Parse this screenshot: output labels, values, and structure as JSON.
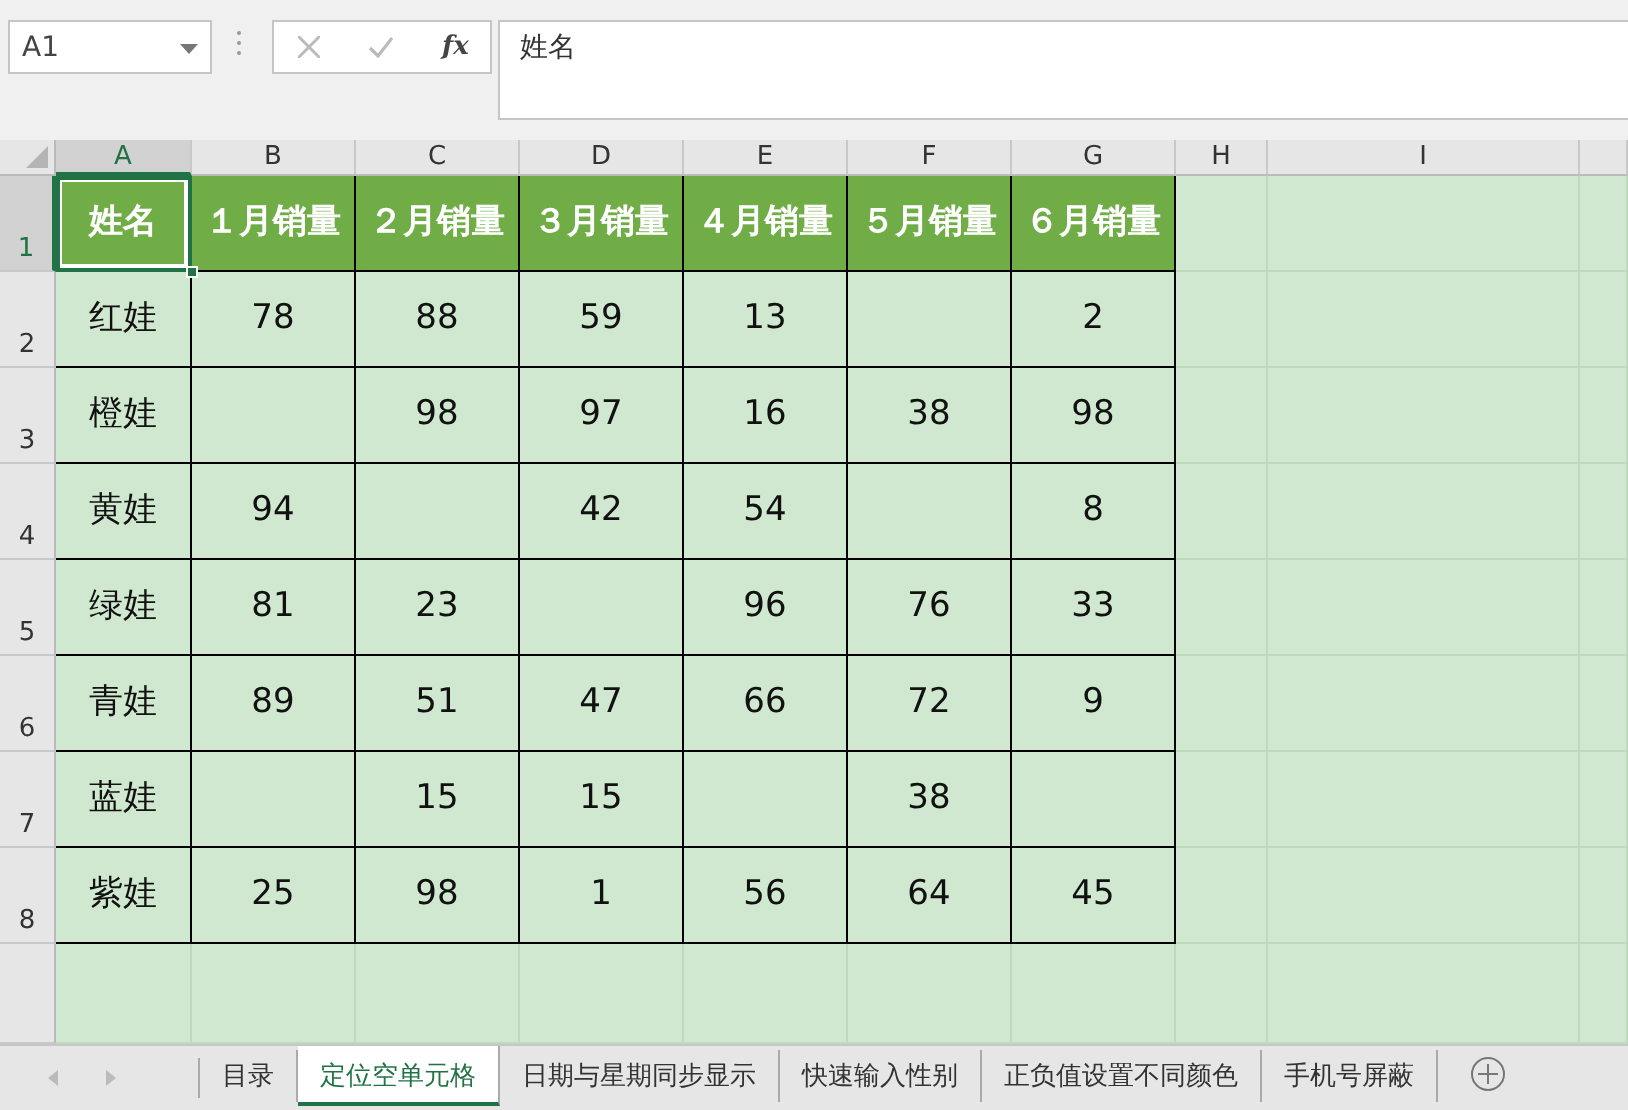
{
  "name_box": {
    "value": "A1"
  },
  "formula_bar": {
    "fx": "fx",
    "value": "姓名"
  },
  "columns": [
    {
      "label": "A",
      "selected": true
    },
    {
      "label": "B",
      "selected": false
    },
    {
      "label": "C",
      "selected": false
    },
    {
      "label": "D",
      "selected": false
    },
    {
      "label": "E",
      "selected": false
    },
    {
      "label": "F",
      "selected": false
    },
    {
      "label": "G",
      "selected": false
    },
    {
      "label": "H",
      "selected": false
    },
    {
      "label": "I",
      "selected": false
    }
  ],
  "rows": [
    {
      "label": "1",
      "kind": "header",
      "selected": true,
      "cells": [
        "姓名",
        "１月销量",
        "２月销量",
        "３月销量",
        "４月销量",
        "５月销量",
        "６月销量"
      ]
    },
    {
      "label": "2",
      "kind": "data",
      "selected": false,
      "cells": [
        "红娃",
        "78",
        "88",
        "59",
        "13",
        "",
        "2"
      ]
    },
    {
      "label": "3",
      "kind": "data",
      "selected": false,
      "cells": [
        "橙娃",
        "",
        "98",
        "97",
        "16",
        "38",
        "98"
      ]
    },
    {
      "label": "4",
      "kind": "data",
      "selected": false,
      "cells": [
        "黄娃",
        "94",
        "",
        "42",
        "54",
        "",
        "8"
      ]
    },
    {
      "label": "5",
      "kind": "data",
      "selected": false,
      "cells": [
        "绿娃",
        "81",
        "23",
        "",
        "96",
        "76",
        "33"
      ]
    },
    {
      "label": "6",
      "kind": "data",
      "selected": false,
      "cells": [
        "青娃",
        "89",
        "51",
        "47",
        "66",
        "72",
        "9"
      ]
    },
    {
      "label": "7",
      "kind": "data",
      "selected": false,
      "cells": [
        "蓝娃",
        "",
        "15",
        "15",
        "",
        "38",
        ""
      ]
    },
    {
      "label": "8",
      "kind": "data",
      "selected": false,
      "cells": [
        "紫娃",
        "25",
        "98",
        "1",
        "56",
        "64",
        "45"
      ]
    }
  ],
  "sheet_tabs": [
    {
      "label": "目录",
      "selected": false
    },
    {
      "label": "定位空单元格",
      "selected": true
    },
    {
      "label": "日期与星期同步显示",
      "selected": false
    },
    {
      "label": "快速输入性别",
      "selected": false
    },
    {
      "label": "正负值设置不同颜色",
      "selected": false
    },
    {
      "label": "手机号屏蔽",
      "selected": false
    }
  ]
}
